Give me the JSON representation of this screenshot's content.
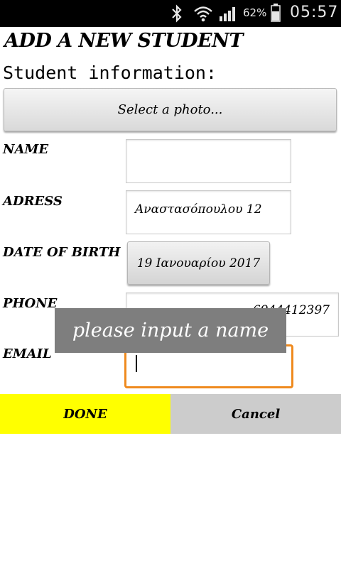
{
  "status_bar": {
    "battery_percent": "62%",
    "time": "05:57",
    "icons": [
      "bluetooth-icon",
      "wifi-icon",
      "signal-icon",
      "battery-icon"
    ]
  },
  "screen": {
    "title": "ADD A NEW STUDENT",
    "subtitle": "Student information:",
    "select_photo_label": "Select a photo..."
  },
  "form": {
    "name": {
      "label": "NAME",
      "value": ""
    },
    "address": {
      "label": "ADRESS",
      "value": "Αναστασόπουλου 12"
    },
    "date_of_birth": {
      "label": "DATE OF BIRTH",
      "value": "19 Ιανουαρίου 2017"
    },
    "phone": {
      "label": "PHONE",
      "value": "6944412397"
    },
    "email": {
      "label": "EMAIL",
      "value": ""
    }
  },
  "toast": {
    "message": "please input a name"
  },
  "actions": {
    "done_label": "DONE",
    "cancel_label": "Cancel"
  },
  "colors": {
    "done_bg": "#ffff00",
    "cancel_bg": "#cccccc",
    "focus_border": "#ef8a1e",
    "toast_bg": "#7e7e7e"
  }
}
